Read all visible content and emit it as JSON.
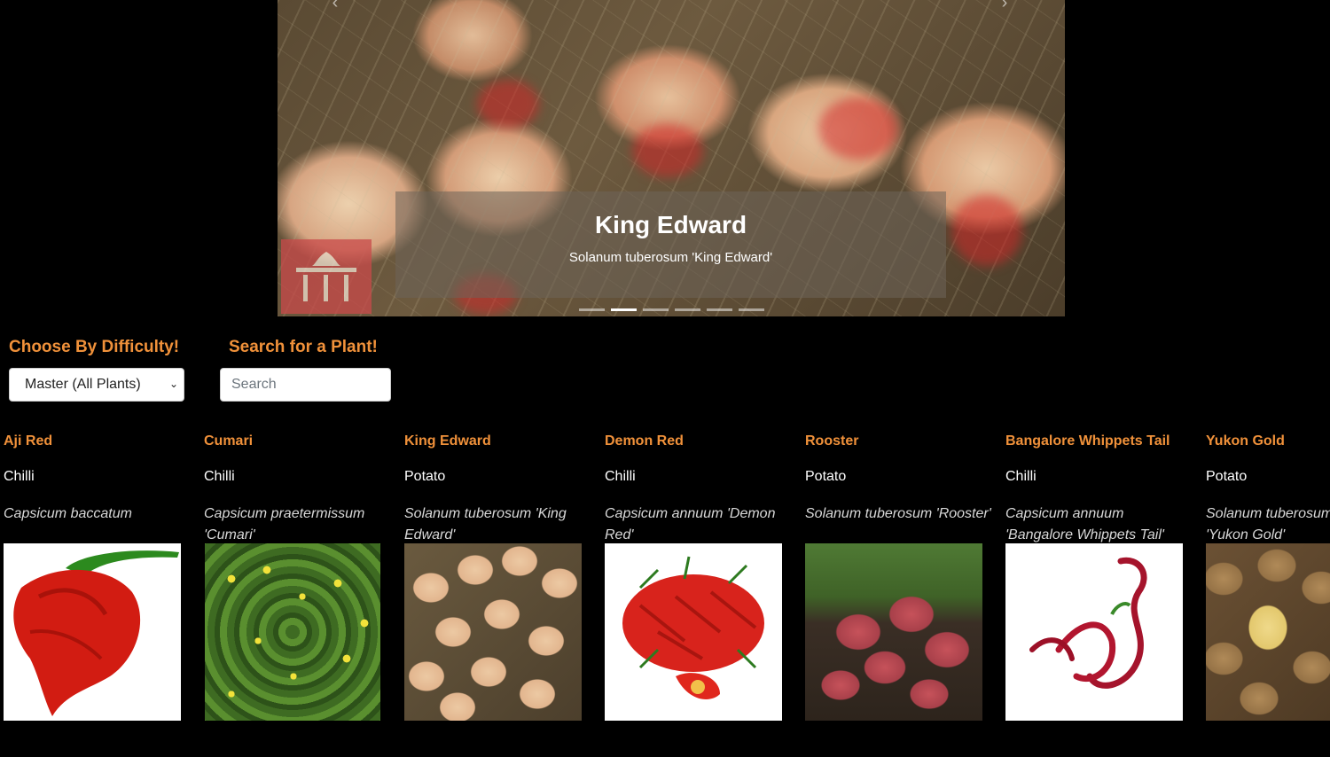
{
  "carousel": {
    "title": "King Edward",
    "subtitle": "Solanum tuberosum 'King Edward'",
    "slide_count": 6,
    "active_index": 1
  },
  "controls": {
    "difficulty_label": "Choose By Difficulty!",
    "difficulty_value": "Master (All Plants)",
    "search_label": "Search for a Plant!",
    "search_placeholder": "Search"
  },
  "plants": [
    {
      "name": "Aji Red",
      "type": "Chilli",
      "scientific": "Capsicum baccatum"
    },
    {
      "name": "Cumari",
      "type": "Chilli",
      "scientific": "Capsicum praetermissum 'Cumari'"
    },
    {
      "name": "King Edward",
      "type": "Potato",
      "scientific": "Solanum tuberosum 'King Edward'"
    },
    {
      "name": "Demon Red",
      "type": "Chilli",
      "scientific": "Capsicum annuum 'Demon Red'"
    },
    {
      "name": "Rooster",
      "type": "Potato",
      "scientific": "Solanum tuberosum 'Rooster'"
    },
    {
      "name": "Bangalore Whippets Tail",
      "type": "Chilli",
      "scientific": "Capsicum annuum 'Bangalore Whippets Tail'"
    },
    {
      "name": "Yukon Gold",
      "type": "Potato",
      "scientific": "Solanum tuberosum 'Yukon Gold'"
    }
  ],
  "colors": {
    "accent": "#f0913a",
    "background": "#000000"
  }
}
